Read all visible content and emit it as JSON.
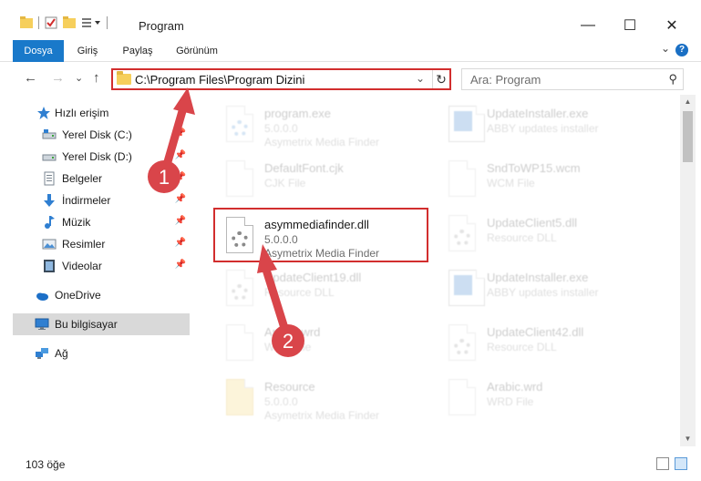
{
  "window": {
    "title": "Program",
    "minimize": "—",
    "maximize": "☐",
    "close": "✕"
  },
  "ribbon": {
    "tabs": [
      "Dosya",
      "Giriş",
      "Paylaş",
      "Görünüm"
    ],
    "help": "?",
    "expand": "⌄"
  },
  "nav": {
    "back": "←",
    "forward": "→",
    "recent": "⌄",
    "up": "↑",
    "address_path": "C:\\Program Files\\Program Dizini",
    "dropdown": "⌄",
    "refresh": "↻",
    "search_placeholder": "Ara: Program",
    "search_icon": "⚲"
  },
  "sidebar": {
    "items": [
      {
        "label": "Hızlı erişim",
        "icon": "star-icon",
        "pinned": false
      },
      {
        "label": "Yerel Disk (C:)",
        "icon": "drive-icon",
        "pinned": true
      },
      {
        "label": "Yerel Disk (D:)",
        "icon": "drive-icon",
        "pinned": true
      },
      {
        "label": "Belgeler",
        "icon": "documents-icon",
        "pinned": true
      },
      {
        "label": "İndirmeler",
        "icon": "download-icon",
        "pinned": true
      },
      {
        "label": "Müzik",
        "icon": "music-icon",
        "pinned": true
      },
      {
        "label": "Resimler",
        "icon": "pictures-icon",
        "pinned": true
      },
      {
        "label": "Videolar",
        "icon": "videos-icon",
        "pinned": true
      },
      {
        "label": "OneDrive",
        "icon": "cloud-icon",
        "pinned": false
      },
      {
        "label": "Bu bilgisayar",
        "icon": "computer-icon",
        "pinned": false
      },
      {
        "label": "Ağ",
        "icon": "network-icon",
        "pinned": false
      }
    ],
    "pin_glyph": "📌"
  },
  "files": [
    {
      "name": "program.exe",
      "line2": "5.0.0.0",
      "line3": "Asymetrix Media Finder",
      "icon": "exe-icon",
      "faded": true
    },
    {
      "name": "UpdateInstaller.exe",
      "line2": "ABBY updates installer",
      "line3": "",
      "icon": "installer-icon",
      "faded": true
    },
    {
      "name": "DefaultFont.cjk",
      "line2": "CJK File",
      "line3": "",
      "icon": "file-icon",
      "faded": true
    },
    {
      "name": "SndToWP15.wcm",
      "line2": "WCM File",
      "line3": "",
      "icon": "file-icon",
      "faded": true
    },
    {
      "name": "asymmediafinder.dll",
      "line2": "5.0.0.0",
      "line3": "Asymetrix Media Finder",
      "icon": "dll-icon",
      "faded": false,
      "highlight": true
    },
    {
      "name": "UpdateClient5.dll",
      "line2": "Resource DLL",
      "line3": "",
      "icon": "dll-icon",
      "faded": true
    },
    {
      "name": "UpdateClient19.dll",
      "line2": "Resource DLL",
      "line3": "",
      "icon": "dll-icon",
      "faded": true
    },
    {
      "name": "UpdateInstaller.exe",
      "line2": "ABBY updates installer",
      "line3": "",
      "icon": "installer-icon",
      "faded": true
    },
    {
      "name": "Arabic.wrd",
      "line2": "WRD File",
      "line3": "",
      "icon": "file-icon",
      "faded": true
    },
    {
      "name": "UpdateClient42.dll",
      "line2": "Resource DLL",
      "line3": "",
      "icon": "dll-icon",
      "faded": true
    },
    {
      "name": "Resource",
      "line2": "5.0.0.0",
      "line3": "Asymetrix Media Finder",
      "icon": "archive-icon",
      "faded": true
    },
    {
      "name": "Arabic.wrd",
      "line2": "WRD File",
      "line3": "",
      "icon": "file-icon",
      "faded": true
    }
  ],
  "annotations": {
    "marker1": "1",
    "marker2": "2",
    "color": "#d9454a"
  },
  "status": {
    "count": "103 öğe"
  }
}
